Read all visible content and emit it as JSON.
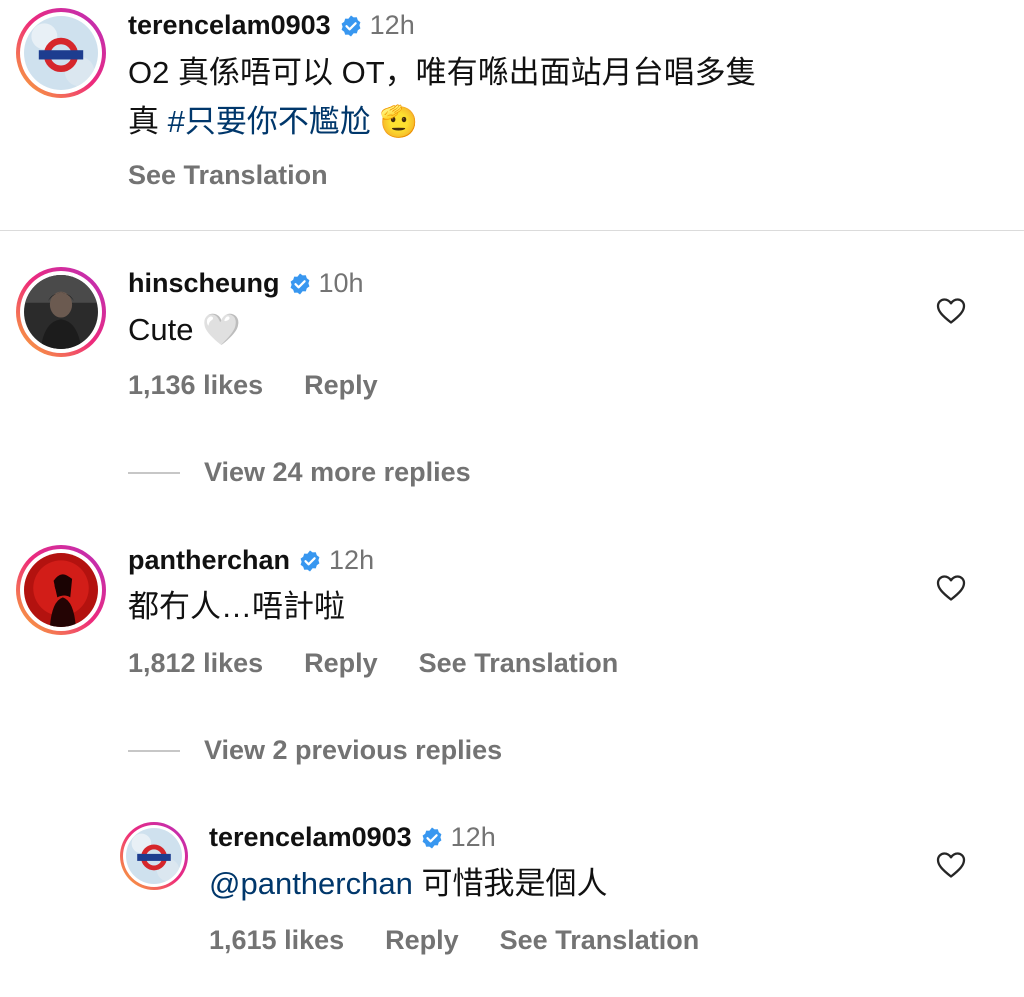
{
  "comments": [
    {
      "username": "terencelam0903",
      "time": "12h",
      "text_line1": "O2 真係唔可以 OT，唯有喺出面站月台唱多隻",
      "text_line2_prefix": "真 ",
      "hashtag": "#只要你不尷尬",
      "emoji": "🫡",
      "see_translation": "See Translation"
    },
    {
      "username": "hinscheung",
      "time": "10h",
      "text": "Cute",
      "emoji": "🤍",
      "likes": "1,136 likes",
      "reply": "Reply",
      "view_more_replies": "View 24 more replies"
    },
    {
      "username": "pantherchan",
      "time": "12h",
      "text": "都冇人…唔計啦",
      "likes": "1,812 likes",
      "reply": "Reply",
      "see_translation": "See Translation",
      "view_previous_replies": "View 2 previous replies"
    },
    {
      "username": "terencelam0903",
      "time": "12h",
      "mention": "@pantherchan",
      "text": " 可惜我是個人",
      "likes": "1,615 likes",
      "reply": "Reply",
      "see_translation": "See Translation"
    }
  ],
  "colors": {
    "verified_badge": "#3897f0",
    "link": "#00376b",
    "secondary_text": "#737373",
    "divider": "#dbdbdb"
  },
  "icons": {
    "verified": "verified-badge-icon",
    "heart": "heart-outline-icon"
  }
}
